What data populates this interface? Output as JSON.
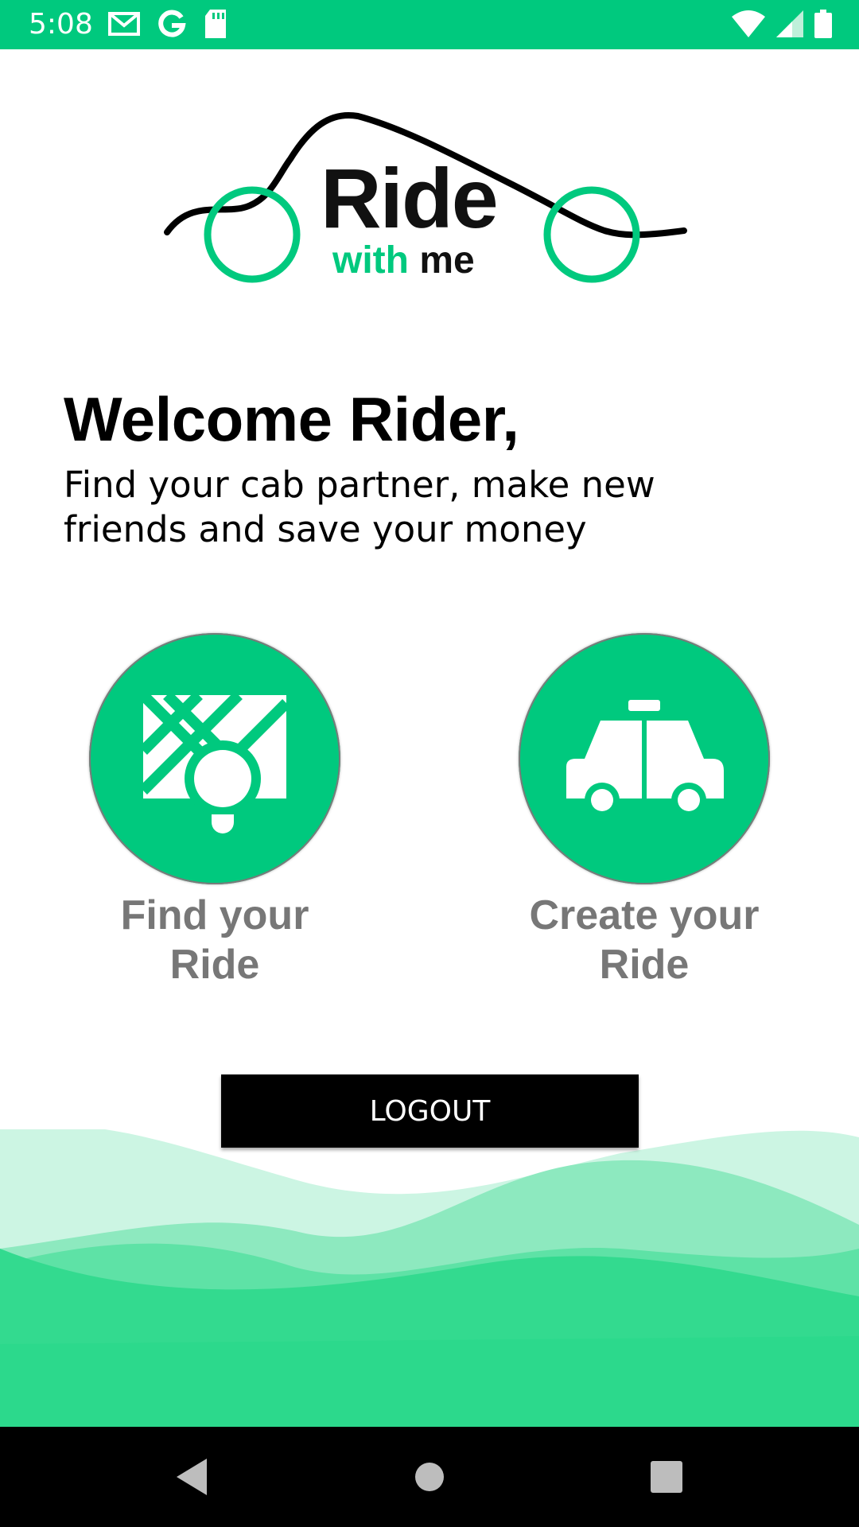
{
  "status_bar": {
    "time": "5:08",
    "background": "#00c97e",
    "left_icons": [
      "gmail-icon",
      "google-icon",
      "sd-card-icon"
    ],
    "right_icons": [
      "wifi-icon",
      "cell-signal-icon",
      "battery-icon"
    ]
  },
  "logo": {
    "word_main": "Ride",
    "word_sub_green": "with",
    "word_sub_dark": "me"
  },
  "welcome": {
    "title": "Welcome Rider,",
    "subtitle": "Find your cab partner, make new friends and save your money"
  },
  "options": [
    {
      "label_line1": "Find your",
      "label_line2": "Ride",
      "icon": "map-pin-icon"
    },
    {
      "label_line1": "Create your",
      "label_line2": "Ride",
      "icon": "taxi-icon"
    }
  ],
  "logout": {
    "label": "LOGOUT"
  },
  "colors": {
    "accent": "#00c97e",
    "wave": "#2fdc90",
    "label_gray": "#777777"
  },
  "nav_bar": {
    "buttons": [
      "back-icon",
      "home-icon",
      "recents-icon"
    ]
  }
}
